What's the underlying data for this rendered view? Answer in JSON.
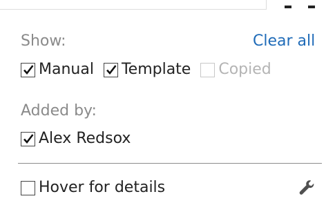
{
  "filters": {
    "show_label": "Show:",
    "clear_all_label": "Clear all",
    "show_options": [
      {
        "label": "Manual",
        "checked": true,
        "disabled": false
      },
      {
        "label": "Template",
        "checked": true,
        "disabled": false
      },
      {
        "label": "Copied",
        "checked": false,
        "disabled": true
      }
    ],
    "added_by_label": "Added by:",
    "added_by_options": [
      {
        "label": "Alex Redsox",
        "checked": true
      }
    ],
    "hover_label": "Hover for details",
    "hover_checked": false
  },
  "icons": {
    "settings": "wrench-icon"
  }
}
